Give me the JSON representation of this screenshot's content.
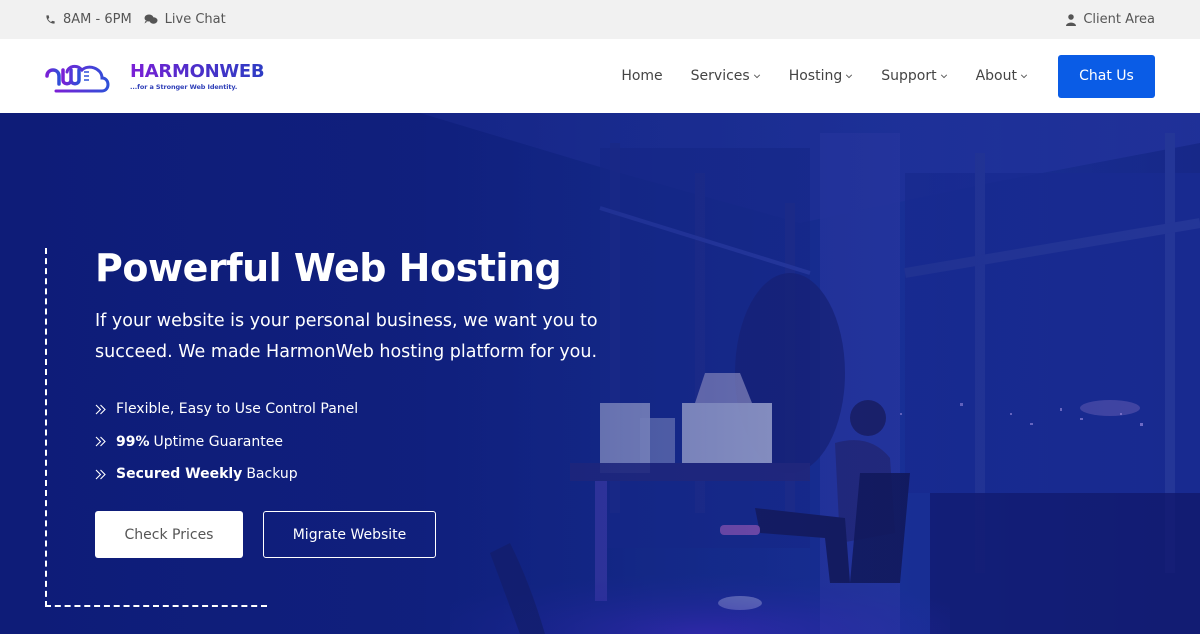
{
  "topbar": {
    "hours": "8AM - 6PM",
    "live_chat": "Live Chat",
    "client_area": "Client Area",
    "icons": {
      "hours": "phone-icon",
      "live_chat": "chat-bubbles-icon",
      "client_area": "user-icon"
    }
  },
  "header": {
    "logo": {
      "mark": "hw",
      "name": "HARMONWEB",
      "tagline": "...for a Stronger Web Identity."
    },
    "nav": [
      {
        "label": "Home",
        "has_dropdown": false
      },
      {
        "label": "Services",
        "has_dropdown": true
      },
      {
        "label": "Hosting",
        "has_dropdown": true
      },
      {
        "label": "Support",
        "has_dropdown": true
      },
      {
        "label": "About",
        "has_dropdown": true
      }
    ],
    "cta_label": "Chat Us"
  },
  "hero": {
    "title": "Powerful Web Hosting",
    "subtitle": "If your website is your personal business, we want you to succeed. We made HarmonWeb hosting platform for you.",
    "features": [
      {
        "bold": "",
        "text": "Flexible, Easy to Use Control Panel"
      },
      {
        "bold": "99%",
        "text": "Uptime Guarantee"
      },
      {
        "bold": "Secured Weekly",
        "text": "Backup"
      }
    ],
    "primary_button": "Check Prices",
    "secondary_button": "Migrate Website",
    "background_image": "man-at-desk-night-office"
  },
  "colors": {
    "accent": "#0a5ce6",
    "hero_overlay": "#10207e",
    "topbar_bg": "#f1f1f1",
    "brand_purple": "#7b1fd6"
  }
}
